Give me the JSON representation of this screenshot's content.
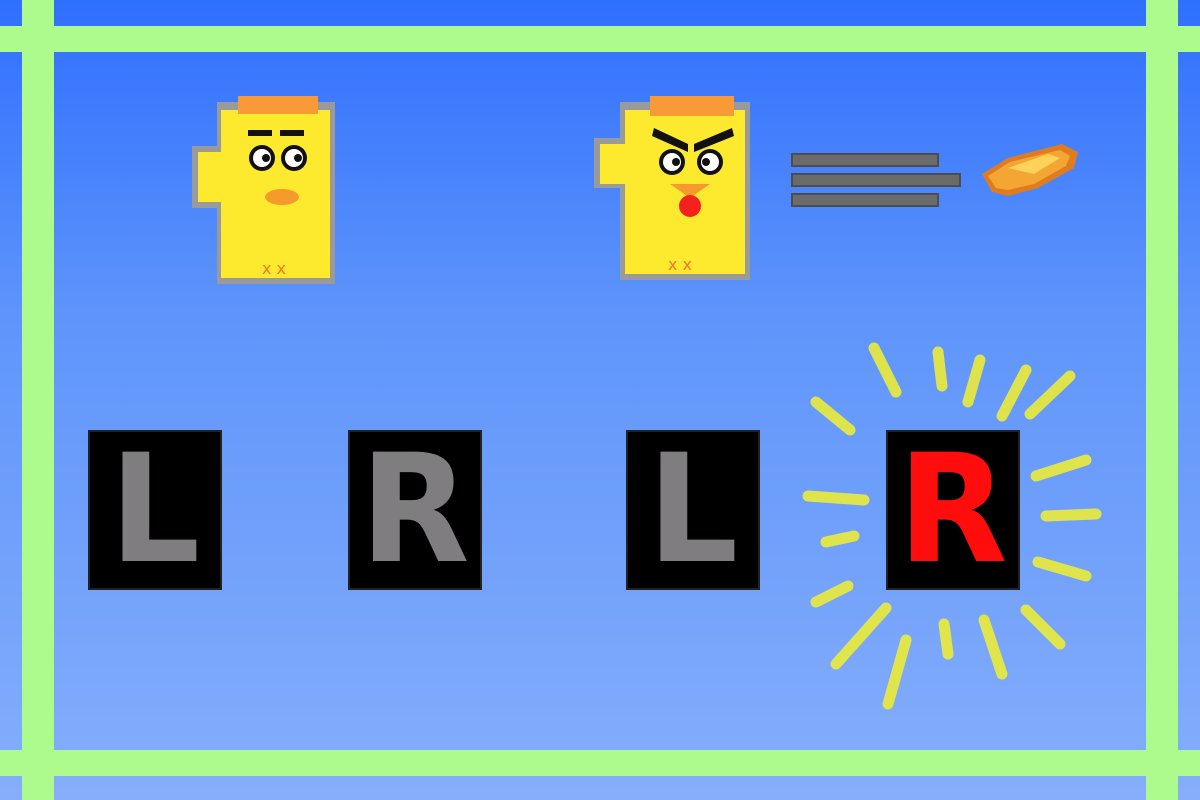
{
  "scene": {
    "colors": {
      "grid": "#aefb8d",
      "sky_top": "#2f6ffe",
      "sky_bottom": "#86aefb",
      "chick_body": "#fde92d",
      "chick_hat": "#f89a38",
      "key_inactive": "#7f7d80",
      "key_active": "#ff0d0d",
      "glow": "#ecec3a"
    },
    "characters": [
      {
        "name": "calm-chick",
        "mood": "calm"
      },
      {
        "name": "angry-chick",
        "mood": "angry",
        "action": "shooting"
      }
    ],
    "keys": [
      {
        "label": "L",
        "active": false
      },
      {
        "label": "R",
        "active": false
      },
      {
        "label": "L",
        "active": false
      },
      {
        "label": "R",
        "active": true
      }
    ]
  }
}
